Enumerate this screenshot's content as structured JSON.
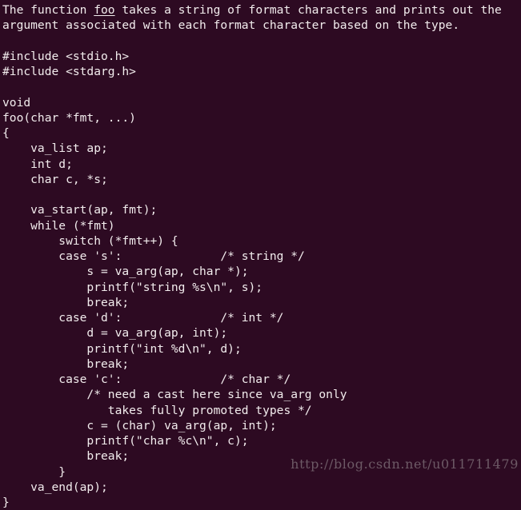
{
  "theme": {
    "background_color": "#2d0a22",
    "text_color": "#f2eced",
    "watermark_color": "#6d5a66"
  },
  "document": {
    "intro": {
      "line1_before": "The function ",
      "line1_emphasis": "foo",
      "line1_after": " takes a string of format characters and prints out the",
      "line2": "argument associated with each format character based on the type."
    },
    "code_lines": [
      "",
      "#include <stdio.h>",
      "#include <stdarg.h>",
      "",
      "void",
      "foo(char *fmt, ...)",
      "{",
      "    va_list ap;",
      "    int d;",
      "    char c, *s;",
      "",
      "    va_start(ap, fmt);",
      "    while (*fmt)",
      "        switch (*fmt++) {",
      "        case 's':              /* string */",
      "            s = va_arg(ap, char *);",
      "            printf(\"string %s\\n\", s);",
      "            break;",
      "        case 'd':              /* int */",
      "            d = va_arg(ap, int);",
      "            printf(\"int %d\\n\", d);",
      "            break;",
      "        case 'c':              /* char */",
      "            /* need a cast here since va_arg only",
      "               takes fully promoted types */",
      "            c = (char) va_arg(ap, int);",
      "            printf(\"char %c\\n\", c);",
      "            break;",
      "        }",
      "    va_end(ap);",
      "}"
    ]
  },
  "watermark": {
    "text": "http://blog.csdn.net/u011711479"
  }
}
